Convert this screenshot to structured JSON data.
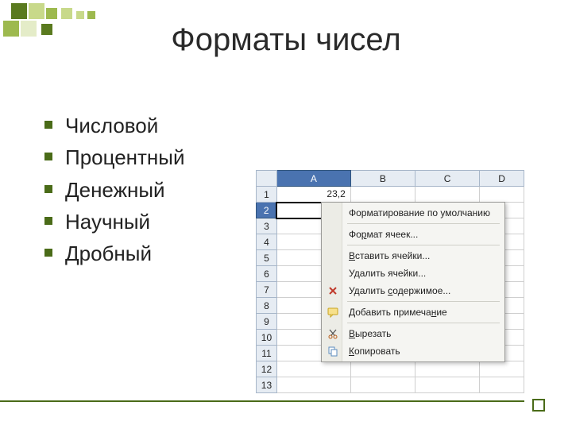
{
  "title": "Форматы чисел",
  "bullets": [
    "Числовой",
    "Процентный",
    "Денежный",
    "Научный",
    "Дробный"
  ],
  "sheet": {
    "cols": [
      "A",
      "B",
      "C",
      "D"
    ],
    "rows": [
      "1",
      "2",
      "3",
      "4",
      "5",
      "6",
      "7",
      "8",
      "9",
      "10",
      "11",
      "12",
      "13"
    ],
    "selected_col": "A",
    "selected_row": "2",
    "cell_A1": "23,2"
  },
  "ctx": {
    "default_fmt": "Форматирование по умолчанию",
    "cells_fmt_pre": "Фо",
    "cells_fmt_u": "р",
    "cells_fmt_post": "мат ячеек...",
    "insert_u": "В",
    "insert_post": "ставить ячейки...",
    "delete_pre": "У",
    "delete_u": "д",
    "delete_post": "алить ячейки...",
    "clear_pre": "Удалить ",
    "clear_u": "с",
    "clear_post": "одержимое...",
    "comment_pre": "Добавить примеча",
    "comment_u": "н",
    "comment_post": "ие",
    "cut_u": "В",
    "cut_post": "ырезать",
    "copy_u": "К",
    "copy_post": "опировать"
  }
}
